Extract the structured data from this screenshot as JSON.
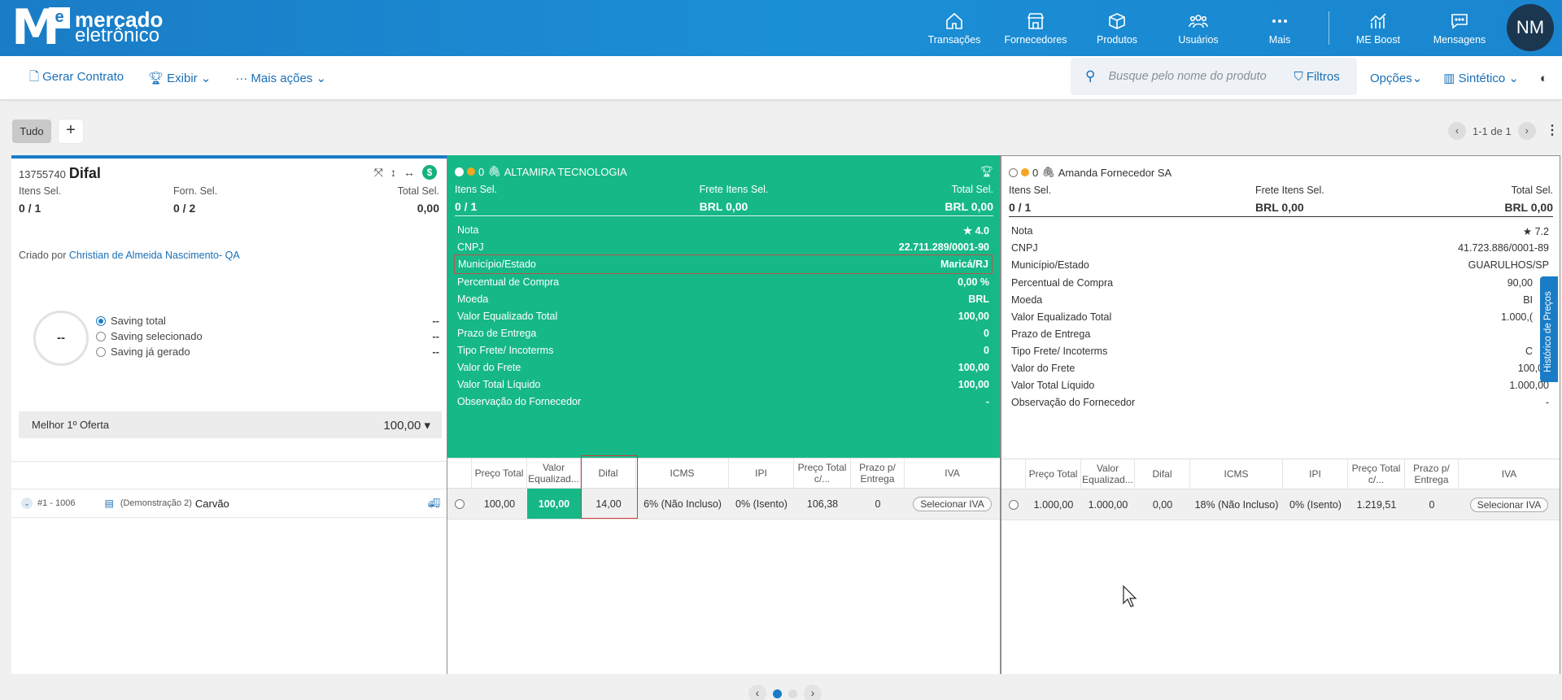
{
  "header": {
    "logo_line1": "mercado",
    "logo_line2": "eletrônico",
    "logo_e": "e",
    "nav": [
      {
        "label": "Transações",
        "icon": "home-icon"
      },
      {
        "label": "Fornecedores",
        "icon": "store-icon"
      },
      {
        "label": "Produtos",
        "icon": "box-icon"
      },
      {
        "label": "Usuários",
        "icon": "users-icon"
      },
      {
        "label": "Mais",
        "icon": "more-icon"
      },
      {
        "label": "ME Boost",
        "icon": "chart-icon"
      },
      {
        "label": "Mensagens",
        "icon": "message-icon"
      }
    ],
    "avatar": "NM"
  },
  "toolbar": {
    "gerar_contrato": "Gerar Contrato",
    "exibir": "Exibir",
    "mais_acoes": "Mais ações",
    "search_placeholder": "Busque pelo nome do produto",
    "filtros": "Filtros",
    "opcoes": "Opções",
    "sintetico": "Sintético"
  },
  "tabs": {
    "tudo": "Tudo",
    "plus": "+"
  },
  "pager": {
    "text": "1-1 de 1"
  },
  "left": {
    "id": "13755740",
    "title": "Difal",
    "itens_sel_label": "Itens Sel.",
    "itens_sel_val": "0 / 1",
    "forn_sel_label": "Forn. Sel.",
    "forn_sel_val": "0 / 2",
    "total_sel_label": "Total Sel.",
    "total_sel_val": "0,00",
    "criado_por_label": "Criado por",
    "criado_por_name": "Christian de Almeida Nascimento- QA",
    "donut": "--",
    "savings": [
      {
        "label": "Saving total",
        "value": "--",
        "selected": true
      },
      {
        "label": "Saving selecionado",
        "value": "--",
        "selected": false
      },
      {
        "label": "Saving já gerado",
        "value": "--",
        "selected": false
      }
    ],
    "melhor_label": "Melhor 1º Oferta",
    "melhor_val": "100,00",
    "item": {
      "num": "#1 - 1006",
      "demo": "(Demonstração 2)",
      "name": "Carvão"
    }
  },
  "supplierA": {
    "count": "0",
    "name": "ALTAMIRA TECNOLOGIA",
    "itens_sel_label": "Itens Sel.",
    "itens_sel_val": "0 / 1",
    "frete_label": "Frete Itens Sel.",
    "frete_val": "BRL 0,00",
    "total_label": "Total Sel.",
    "total_val": "BRL 0,00",
    "attrs": [
      {
        "label": "Nota",
        "value": "4.0"
      },
      {
        "label": "CNPJ",
        "value": "22.711.289/0001-90"
      },
      {
        "label": "Município/Estado",
        "value": "Maricá/RJ"
      },
      {
        "label": "Percentual de Compra",
        "value": "0,00 %"
      },
      {
        "label": "Moeda",
        "value": "BRL"
      },
      {
        "label": "Valor Equalizado Total",
        "value": "100,00"
      },
      {
        "label": "Prazo de Entrega",
        "value": "0"
      },
      {
        "label": "Tipo Frete/ Incoterms",
        "value": "0"
      },
      {
        "label": "Valor do Frete",
        "value": "100,00"
      },
      {
        "label": "Valor Total Líquido",
        "value": "100,00"
      },
      {
        "label": "Observação do Fornecedor",
        "value": "-"
      }
    ],
    "row": {
      "preco_total": "100,00",
      "valor_eq": "100,00",
      "difal": "14,00",
      "icms": "6% (Não Incluso)",
      "ipi": "0% (Isento)",
      "preco_total_c": "106,38",
      "prazo": "0",
      "iva": "Selecionar IVA"
    }
  },
  "supplierB": {
    "count": "0",
    "name": "Amanda Fornecedor SA",
    "itens_sel_label": "Itens Sel.",
    "itens_sel_val": "0 / 1",
    "frete_label": "Frete Itens Sel.",
    "frete_val": "BRL 0,00",
    "total_label": "Total Sel.",
    "total_val": "BRL 0,00",
    "attrs": [
      {
        "label": "Nota",
        "value": "7.2"
      },
      {
        "label": "CNPJ",
        "value": "41.723.886/0001-89"
      },
      {
        "label": "Município/Estado",
        "value": "GUARULHOS/SP"
      },
      {
        "label": "Percentual de Compra",
        "value": "90,00"
      },
      {
        "label": "Moeda",
        "value": "BI"
      },
      {
        "label": "Valor Equalizado Total",
        "value": "1.000,("
      },
      {
        "label": "Prazo de Entrega",
        "value": ""
      },
      {
        "label": "Tipo Frete/ Incoterms",
        "value": "C"
      },
      {
        "label": "Valor do Frete",
        "value": "100,00"
      },
      {
        "label": "Valor Total Líquido",
        "value": "1.000,00"
      },
      {
        "label": "Observação do Fornecedor",
        "value": "-"
      }
    ],
    "row": {
      "preco_total": "1.000,00",
      "valor_eq": "1.000,00",
      "difal": "0,00",
      "icms": "18% (Não Incluso)",
      "ipi": "0% (Isento)",
      "preco_total_c": "1.219,51",
      "prazo": "0",
      "iva": "Selecionar IVA"
    }
  },
  "columns": {
    "preco_total": "Preço Total",
    "valor_eq": "Valor Equalizad...",
    "difal": "Difal",
    "icms": "ICMS",
    "ipi": "IPI",
    "preco_total_c": "Preço Total c/...",
    "prazo": "Prazo p/ Entrega",
    "iva": "IVA"
  },
  "historico": "Histórico de Preços"
}
